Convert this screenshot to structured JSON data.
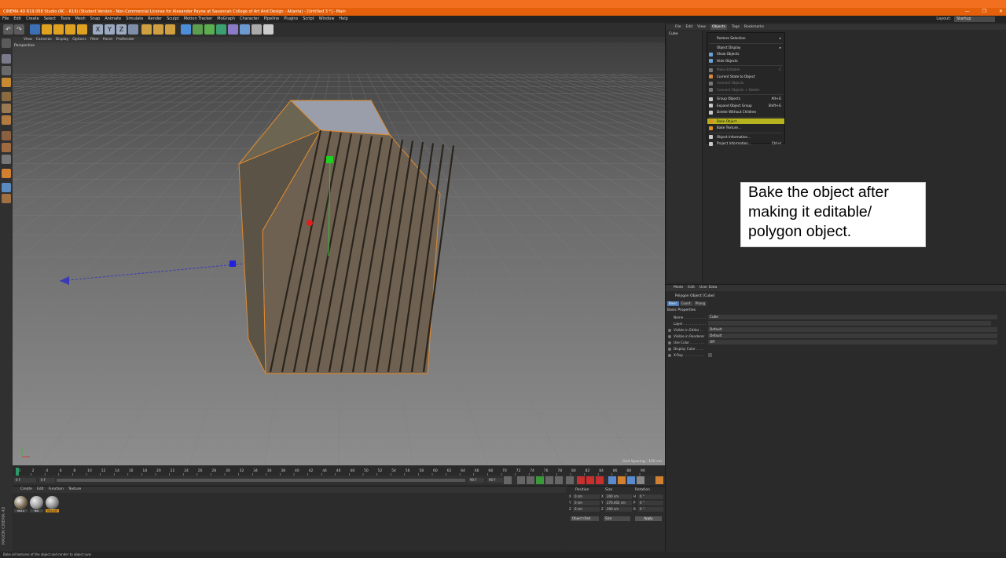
{
  "title_bar": {
    "text": "CINEMA 4D R19.068 Studio (RC - R19) (Student Version - Non-Commercial License for Alexander Payne at Savannah College of Art And Design - Atlanta) - [Untitled 3 *] - Main",
    "controls": [
      "—",
      "❐",
      "✕"
    ]
  },
  "menu": [
    "File",
    "Edit",
    "Create",
    "Select",
    "Tools",
    "Mesh",
    "Snap",
    "Animate",
    "Simulate",
    "Render",
    "Sculpt",
    "Motion Tracker",
    "MoGraph",
    "Character",
    "Pipeline",
    "Plugins",
    "Script",
    "Window",
    "Help"
  ],
  "layout": {
    "label": "Layout:",
    "value": "Startup"
  },
  "viewport": {
    "menu": [
      "View",
      "Cameras",
      "Display",
      "Options",
      "Filter",
      "Panel",
      "ProRender"
    ],
    "label": "Perspective",
    "grid_spacing": "Grid Spacing : 100 cm"
  },
  "timeline": {
    "ticks": [
      "0",
      "2",
      "4",
      "6",
      "8",
      "10",
      "12",
      "14",
      "16",
      "18",
      "20",
      "22",
      "24",
      "26",
      "28",
      "30",
      "32",
      "34",
      "36",
      "38",
      "40",
      "42",
      "44",
      "46",
      "48",
      "50",
      "52",
      "54",
      "56",
      "58",
      "60",
      "62",
      "64",
      "66",
      "68",
      "70",
      "72",
      "74",
      "76",
      "78",
      "80",
      "82",
      "84",
      "86",
      "88",
      "90"
    ],
    "current": "0 F",
    "start": "0 F",
    "end": "90 F",
    "end2": "90 F"
  },
  "material_manager": {
    "menu": [
      "Create",
      "Edit",
      "Function",
      "Texture"
    ],
    "materials": [
      {
        "name": "Mat.2",
        "color": "#7a6a50"
      },
      {
        "name": "Mat",
        "color": "#9a9a9a"
      },
      {
        "name": "Mat.edit",
        "color": "#8a8a8a"
      }
    ]
  },
  "coordinates": {
    "headers": [
      "Position",
      "Size",
      "Rotation"
    ],
    "rows": [
      {
        "axis": "X",
        "pos": "0 cm",
        "size_axis": "X",
        "size": "200 cm",
        "rot_axis": "H",
        "rot": "0 °"
      },
      {
        "axis": "Y",
        "pos": "0 cm",
        "size_axis": "Y",
        "size": "276.402 cm",
        "rot_axis": "P",
        "rot": "0 °"
      },
      {
        "axis": "Z",
        "pos": "0 cm",
        "size_axis": "Z",
        "size": "200 cm",
        "rot_axis": "B",
        "rot": "0 °"
      }
    ],
    "mode": "Object (Rel)",
    "size_mode": "Size",
    "apply": "Apply"
  },
  "status_bar": "Bake all textures of the object and render to object uvw",
  "maxon_logo": "MAXON CINEMA 4D",
  "object_manager": {
    "menu": [
      "File",
      "Edit",
      "View",
      "Objects",
      "Tags",
      "Bookmarks"
    ],
    "active_menu": "Objects",
    "items": [
      {
        "name": "Cube"
      }
    ]
  },
  "objects_menu": [
    {
      "label": "Restore Selection",
      "shortcut": "▸",
      "disabled": false,
      "icon": ""
    },
    {
      "sep": true
    },
    {
      "label": "Object Display",
      "shortcut": "▸",
      "disabled": false,
      "icon": ""
    },
    {
      "label": "Show Objects",
      "shortcut": "",
      "disabled": false,
      "icon": "#6aa0d8"
    },
    {
      "label": "Hide Objects",
      "shortcut": "",
      "disabled": false,
      "icon": "#6aa0d8"
    },
    {
      "sep": true
    },
    {
      "label": "Make Editable",
      "shortcut": "C",
      "disabled": true,
      "icon": "#777777"
    },
    {
      "label": "Current State to Object",
      "shortcut": "",
      "disabled": false,
      "icon": "#d88a3a"
    },
    {
      "label": "Connect Objects",
      "shortcut": "",
      "disabled": true,
      "icon": "#777777"
    },
    {
      "label": "Connect Objects + Delete",
      "shortcut": "",
      "disabled": true,
      "icon": "#777777"
    },
    {
      "sep": true
    },
    {
      "label": "Group Objects",
      "shortcut": "Alt+G",
      "disabled": false,
      "icon": "#c8c8c8"
    },
    {
      "label": "Expand Object Group",
      "shortcut": "Shift+G",
      "disabled": false,
      "icon": "#c8c8c8"
    },
    {
      "label": "Delete Without Children",
      "shortcut": "",
      "disabled": false,
      "icon": "#c8c8c8"
    },
    {
      "sep": true
    },
    {
      "label": "Bake Object...",
      "shortcut": "",
      "disabled": false,
      "icon": "#e09020",
      "highlight": true
    },
    {
      "label": "Bake Texture...",
      "shortcut": "",
      "disabled": false,
      "icon": "#e09020"
    },
    {
      "sep": true
    },
    {
      "label": "Object Information...",
      "shortcut": "",
      "disabled": false,
      "icon": "#c8c8c8"
    },
    {
      "label": "Project Information...",
      "shortcut": "Ctrl+I",
      "disabled": false,
      "icon": "#c8c8c8"
    }
  ],
  "callout": {
    "lines": [
      "Bake the object after",
      "making it editable/",
      "polygon object."
    ]
  },
  "attribute_manager": {
    "menu": [
      "Mode",
      "Edit",
      "User Data"
    ],
    "title": "Polygon Object [Cube]",
    "tabs": [
      "Basic",
      "Coord.",
      "Phong"
    ],
    "selected_tab": "Basic",
    "section": "Basic Properties",
    "rows": [
      {
        "label": "Name . . . . . . . . . . .",
        "value": "Cube"
      },
      {
        "label": "Layer . . . . . . . . . . .",
        "value": ""
      },
      {
        "label": "Visible in Editor . .",
        "value": "Default"
      },
      {
        "label": "Visible in Renderer",
        "value": "Default"
      },
      {
        "label": "Use Color . . . . . . .",
        "value": "Off"
      },
      {
        "label": "Display Color . . . .",
        "value": ""
      },
      {
        "label": "X-Ray . . . . . . . . . .",
        "value": ""
      }
    ]
  }
}
